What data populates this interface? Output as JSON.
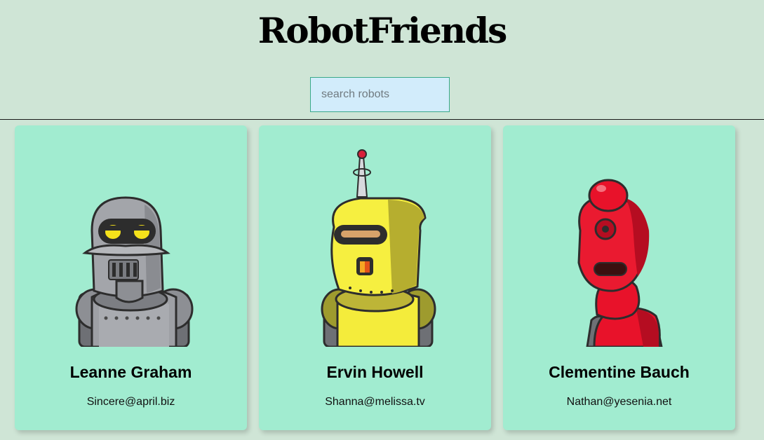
{
  "app": {
    "title": "RobotFriends"
  },
  "search": {
    "placeholder": "search robots",
    "value": ""
  },
  "robots": [
    {
      "name": "Leanne Graham",
      "email": "Sincere@april.biz",
      "image_icon": "gray-robot-icon"
    },
    {
      "name": "Ervin Howell",
      "email": "Shanna@melissa.tv",
      "image_icon": "yellow-robot-icon"
    },
    {
      "name": "Clementine Bauch",
      "email": "Nathan@yesenia.net",
      "image_icon": "red-robot-icon"
    }
  ],
  "colors": {
    "page_background": "#cfe5d6",
    "card_background": "#a1ecd0",
    "search_background": "#d2ecfb",
    "search_border": "#3aa98a"
  }
}
